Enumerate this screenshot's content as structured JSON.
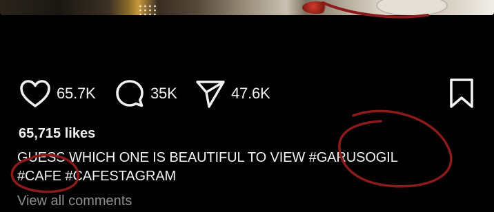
{
  "post": {
    "actions": {
      "like_count": "65.7K",
      "comment_count": "35K",
      "share_count": "47.6K"
    },
    "likes_text": "65,715 likes",
    "caption": {
      "text": "GUESS WHICH ONE IS BEAUTIFUL TO VIEW",
      "hashtags": [
        "#GARUSOGIL",
        "#CAFE",
        "#CAFESTAGRAM"
      ]
    },
    "view_all_comments": "View all comments"
  },
  "icons": {
    "like": "heart-icon",
    "comment": "comment-bubble-icon",
    "share": "paper-plane-icon",
    "save": "bookmark-icon"
  },
  "colors": {
    "background": "#000000",
    "text": "#f2f2f2",
    "muted": "#8e8e8e",
    "annotation": "#8b1a1a"
  }
}
